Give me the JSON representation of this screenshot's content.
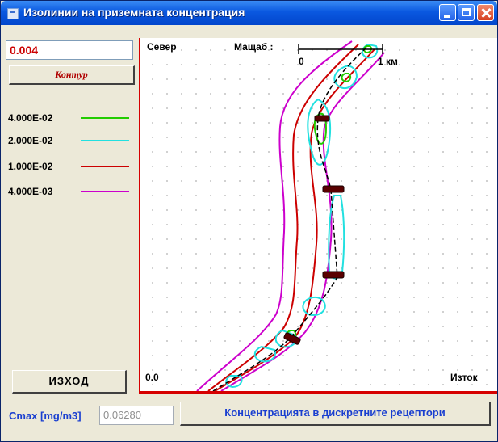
{
  "window": {
    "title": "Изолинии на приземната концентрация"
  },
  "left_panel": {
    "concentration_value": "0.004",
    "contour_button": "Контур",
    "legend": [
      {
        "label": "4.000E-02",
        "color": "#22cc00"
      },
      {
        "label": "2.000E-02",
        "color": "#22e0e0"
      },
      {
        "label": "1.000E-02",
        "color": "#cc0000"
      },
      {
        "label": "4.000E-03",
        "color": "#cc00cc"
      }
    ],
    "exit_button": "ИЗХОД"
  },
  "map": {
    "north_label": "Север",
    "scale_label": "Мащаб :",
    "scale_start": "0",
    "scale_end": "1 км",
    "origin_label": "0.0",
    "east_label": "Изток"
  },
  "bottom": {
    "cmax_label": "Cmax [mg/m3]",
    "cmax_value": "0.06280",
    "receptors_button": "Концентрацията в дискретните рецептори"
  }
}
